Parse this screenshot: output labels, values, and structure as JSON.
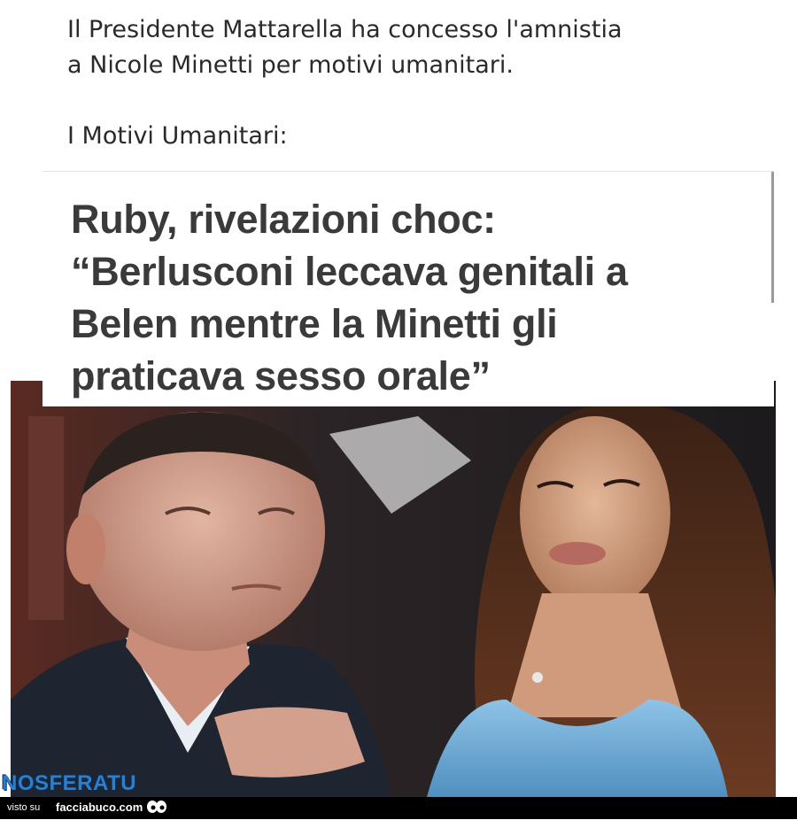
{
  "intro": {
    "line1": "Il Presidente Mattarella ha concesso l'amnistia",
    "line2": "a Nicole Minetti per motivi umanitari.",
    "line3": "I Motivi Umanitari:"
  },
  "headline": {
    "line1": "Ruby, rivelazioni choc:",
    "line2": "“Berlusconi leccava genitali a",
    "line3": "Belen mentre la Minetti gli",
    "line4": "praticava sesso orale”"
  },
  "watermark": "NOSFERATU",
  "footer": {
    "prefix": "visto su",
    "site": "facciabuco.com"
  },
  "colors": {
    "watermark": "#2b7fcf",
    "footer_bg": "#000000",
    "headline_text": "#3a3a3a"
  }
}
